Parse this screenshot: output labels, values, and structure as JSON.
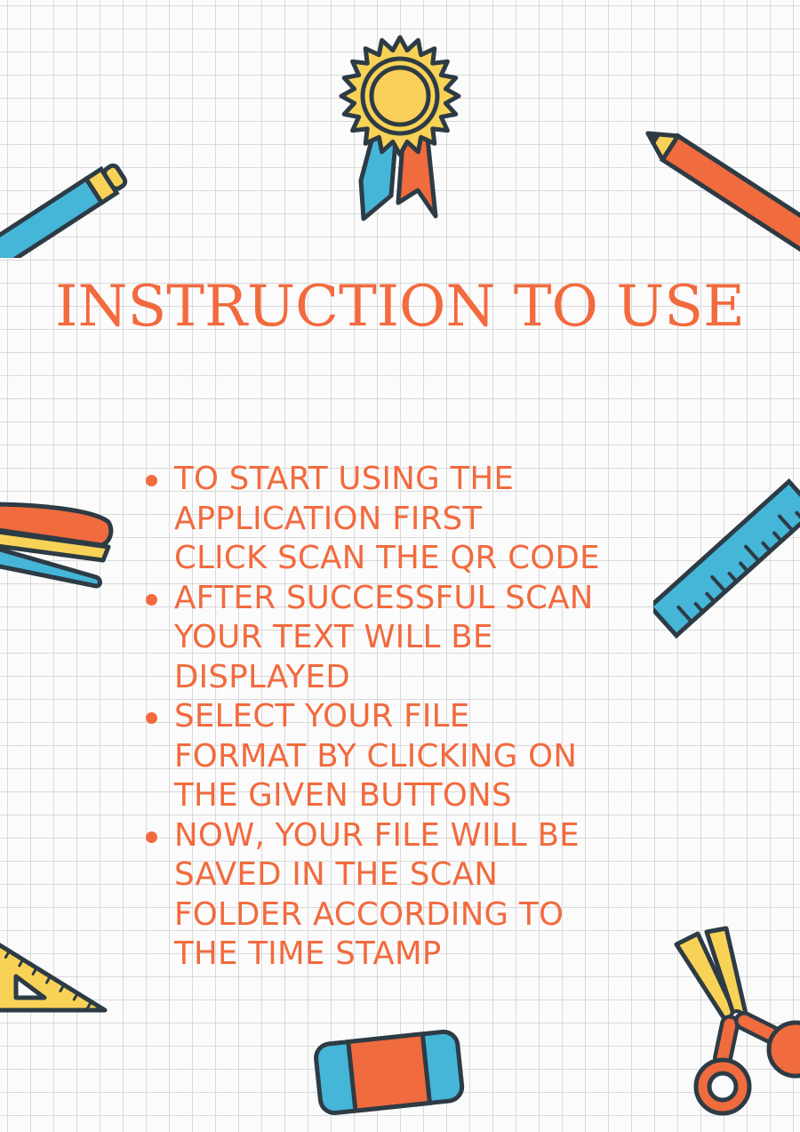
{
  "title": "INSTRUCTION TO USE",
  "colors": {
    "accent": "#f26a3d",
    "outline": "#2d3b45",
    "blue": "#45b5d8",
    "yellow": "#f8d257",
    "orange": "#f06b3d"
  },
  "steps": [
    {
      "text": "TO START USING THE\nAPPLICATION FIRST\nCLICK SCAN THE QR CODE"
    },
    {
      "text": "AFTER SUCCESSFUL SCAN\nYOUR TEXT WILL BE\nDISPLAYED"
    },
    {
      "text": "SELECT YOUR FILE\nFORMAT BY CLICKING ON\nTHE GIVEN BUTTONS"
    },
    {
      "text": "NOW, YOUR FILE WILL BE\nSAVED IN THE SCAN\nFOLDER ACCORDING TO\nTHE TIME STAMP"
    }
  ],
  "icons": [
    "award-ribbon-icon",
    "blue-pencil-icon",
    "orange-pencil-icon",
    "stapler-icon",
    "ruler-icon",
    "set-square-icon",
    "eraser-icon",
    "scissors-icon"
  ]
}
